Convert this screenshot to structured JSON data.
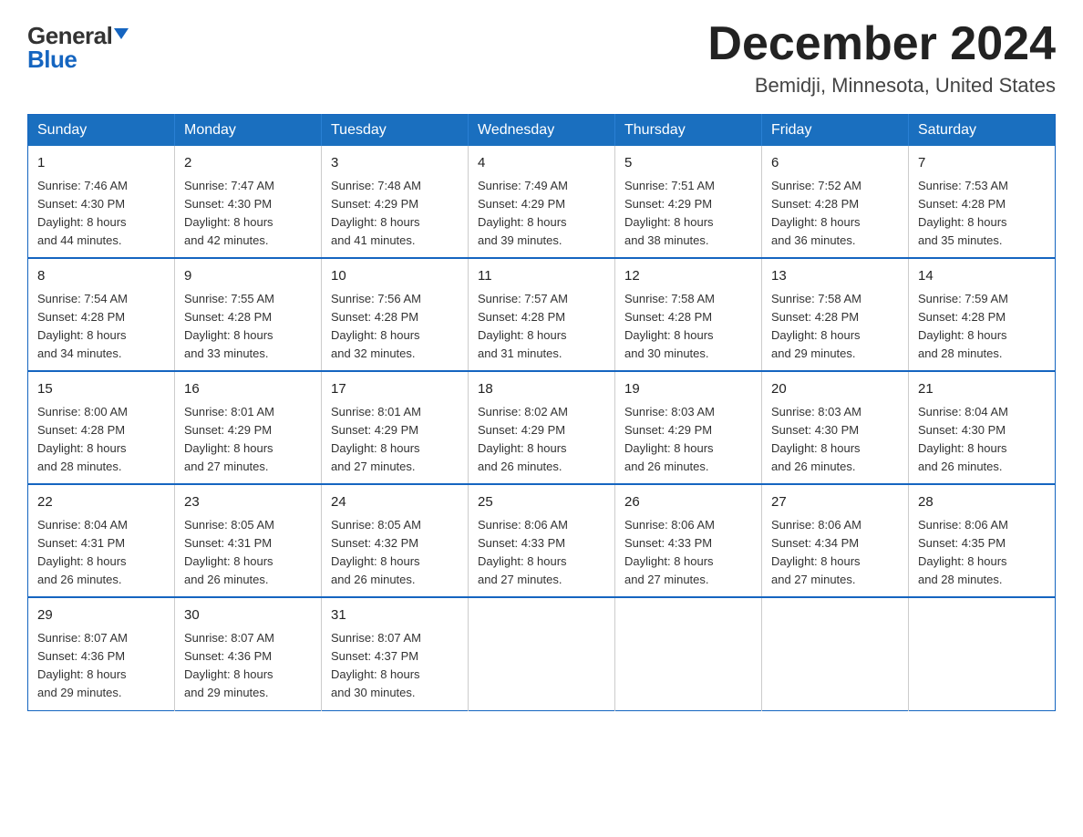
{
  "header": {
    "logo_general": "General",
    "logo_blue": "Blue",
    "month_title": "December 2024",
    "location": "Bemidji, Minnesota, United States"
  },
  "days_of_week": [
    "Sunday",
    "Monday",
    "Tuesday",
    "Wednesday",
    "Thursday",
    "Friday",
    "Saturday"
  ],
  "weeks": [
    [
      {
        "day": "1",
        "sunrise": "7:46 AM",
        "sunset": "4:30 PM",
        "daylight": "8 hours and 44 minutes."
      },
      {
        "day": "2",
        "sunrise": "7:47 AM",
        "sunset": "4:30 PM",
        "daylight": "8 hours and 42 minutes."
      },
      {
        "day": "3",
        "sunrise": "7:48 AM",
        "sunset": "4:29 PM",
        "daylight": "8 hours and 41 minutes."
      },
      {
        "day": "4",
        "sunrise": "7:49 AM",
        "sunset": "4:29 PM",
        "daylight": "8 hours and 39 minutes."
      },
      {
        "day": "5",
        "sunrise": "7:51 AM",
        "sunset": "4:29 PM",
        "daylight": "8 hours and 38 minutes."
      },
      {
        "day": "6",
        "sunrise": "7:52 AM",
        "sunset": "4:28 PM",
        "daylight": "8 hours and 36 minutes."
      },
      {
        "day": "7",
        "sunrise": "7:53 AM",
        "sunset": "4:28 PM",
        "daylight": "8 hours and 35 minutes."
      }
    ],
    [
      {
        "day": "8",
        "sunrise": "7:54 AM",
        "sunset": "4:28 PM",
        "daylight": "8 hours and 34 minutes."
      },
      {
        "day": "9",
        "sunrise": "7:55 AM",
        "sunset": "4:28 PM",
        "daylight": "8 hours and 33 minutes."
      },
      {
        "day": "10",
        "sunrise": "7:56 AM",
        "sunset": "4:28 PM",
        "daylight": "8 hours and 32 minutes."
      },
      {
        "day": "11",
        "sunrise": "7:57 AM",
        "sunset": "4:28 PM",
        "daylight": "8 hours and 31 minutes."
      },
      {
        "day": "12",
        "sunrise": "7:58 AM",
        "sunset": "4:28 PM",
        "daylight": "8 hours and 30 minutes."
      },
      {
        "day": "13",
        "sunrise": "7:58 AM",
        "sunset": "4:28 PM",
        "daylight": "8 hours and 29 minutes."
      },
      {
        "day": "14",
        "sunrise": "7:59 AM",
        "sunset": "4:28 PM",
        "daylight": "8 hours and 28 minutes."
      }
    ],
    [
      {
        "day": "15",
        "sunrise": "8:00 AM",
        "sunset": "4:28 PM",
        "daylight": "8 hours and 28 minutes."
      },
      {
        "day": "16",
        "sunrise": "8:01 AM",
        "sunset": "4:29 PM",
        "daylight": "8 hours and 27 minutes."
      },
      {
        "day": "17",
        "sunrise": "8:01 AM",
        "sunset": "4:29 PM",
        "daylight": "8 hours and 27 minutes."
      },
      {
        "day": "18",
        "sunrise": "8:02 AM",
        "sunset": "4:29 PM",
        "daylight": "8 hours and 26 minutes."
      },
      {
        "day": "19",
        "sunrise": "8:03 AM",
        "sunset": "4:29 PM",
        "daylight": "8 hours and 26 minutes."
      },
      {
        "day": "20",
        "sunrise": "8:03 AM",
        "sunset": "4:30 PM",
        "daylight": "8 hours and 26 minutes."
      },
      {
        "day": "21",
        "sunrise": "8:04 AM",
        "sunset": "4:30 PM",
        "daylight": "8 hours and 26 minutes."
      }
    ],
    [
      {
        "day": "22",
        "sunrise": "8:04 AM",
        "sunset": "4:31 PM",
        "daylight": "8 hours and 26 minutes."
      },
      {
        "day": "23",
        "sunrise": "8:05 AM",
        "sunset": "4:31 PM",
        "daylight": "8 hours and 26 minutes."
      },
      {
        "day": "24",
        "sunrise": "8:05 AM",
        "sunset": "4:32 PM",
        "daylight": "8 hours and 26 minutes."
      },
      {
        "day": "25",
        "sunrise": "8:06 AM",
        "sunset": "4:33 PM",
        "daylight": "8 hours and 27 minutes."
      },
      {
        "day": "26",
        "sunrise": "8:06 AM",
        "sunset": "4:33 PM",
        "daylight": "8 hours and 27 minutes."
      },
      {
        "day": "27",
        "sunrise": "8:06 AM",
        "sunset": "4:34 PM",
        "daylight": "8 hours and 27 minutes."
      },
      {
        "day": "28",
        "sunrise": "8:06 AM",
        "sunset": "4:35 PM",
        "daylight": "8 hours and 28 minutes."
      }
    ],
    [
      {
        "day": "29",
        "sunrise": "8:07 AM",
        "sunset": "4:36 PM",
        "daylight": "8 hours and 29 minutes."
      },
      {
        "day": "30",
        "sunrise": "8:07 AM",
        "sunset": "4:36 PM",
        "daylight": "8 hours and 29 minutes."
      },
      {
        "day": "31",
        "sunrise": "8:07 AM",
        "sunset": "4:37 PM",
        "daylight": "8 hours and 30 minutes."
      },
      null,
      null,
      null,
      null
    ]
  ],
  "labels": {
    "sunrise": "Sunrise:",
    "sunset": "Sunset:",
    "daylight": "Daylight:"
  }
}
